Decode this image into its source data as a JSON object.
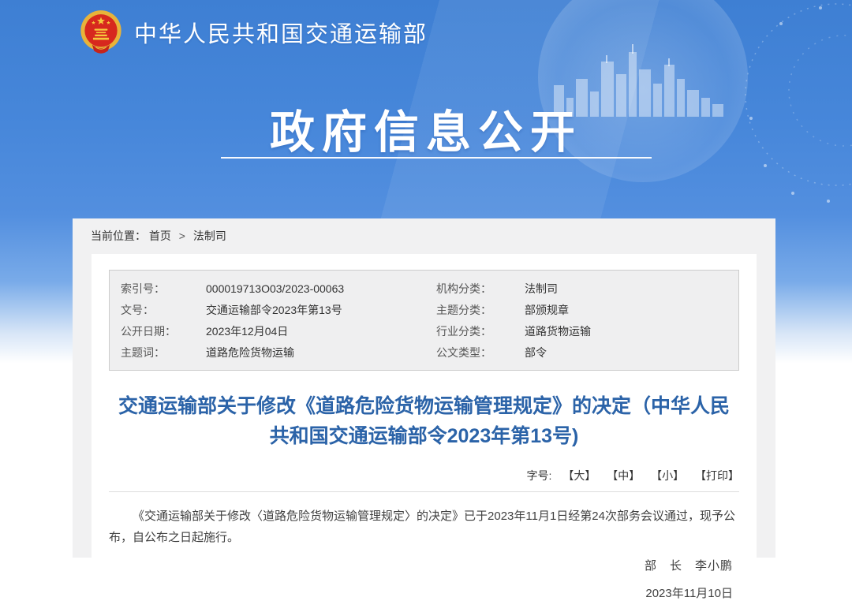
{
  "header": {
    "site_name": "中华人民共和国交通运输部",
    "page_title": "政府信息公开",
    "emblem_icon": "national-emblem",
    "decor": "city-skyline-watermark"
  },
  "breadcrumb": {
    "label": "当前位置：",
    "home": "首页",
    "separator": ">",
    "section": "法制司"
  },
  "meta_table": {
    "rows": [
      {
        "label_left": "索引号：",
        "value_left": "000019713O03/2023-00063",
        "label_right": "机构分类：",
        "value_right": "法制司"
      },
      {
        "label_left": "文号：",
        "value_left": "交通运输部令2023年第13号",
        "label_right": "主题分类：",
        "value_right": "部颁规章"
      },
      {
        "label_left": "公开日期：",
        "value_left": "2023年12月04日",
        "label_right": "行业分类：",
        "value_right": "道路货物运输"
      },
      {
        "label_left": "主题词：",
        "value_left": "道路危险货物运输",
        "label_right": "公文类型：",
        "value_right": "部令"
      }
    ]
  },
  "article": {
    "title": "交通运输部关于修改《道路危险货物运输管理规定》的决定（中华人民共和国交通运输部令2023年第13号)",
    "font_size_label": "字号:",
    "font_size_options": [
      "【大】",
      "【中】",
      "【小】"
    ],
    "print_label": "【打印】",
    "body": "《交通运输部关于修改〈道路危险货物运输管理规定〉的决定》已于2023年11月1日经第24次部务会议通过，现予公布，自公布之日起施行。",
    "signer": "部　长　李小鹏",
    "date": "2023年11月10日"
  },
  "colors": {
    "banner_blue": "#4787da",
    "article_title_blue": "#2b63a8",
    "emblem_red": "#d7281e",
    "emblem_gold": "#e8b33a",
    "panel_gray": "#f1f1f2",
    "table_gray": "#efeff0"
  }
}
